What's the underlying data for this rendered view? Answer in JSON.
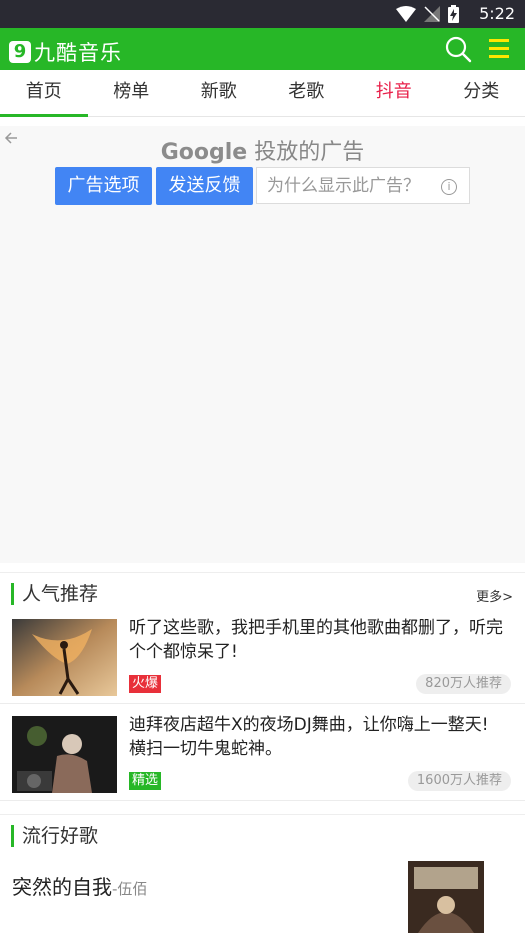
{
  "status_bar": {
    "time": "5:22",
    "icons": [
      "wifi-icon",
      "no-signal-icon",
      "battery-charging-icon"
    ]
  },
  "app_bar": {
    "logo_digit": "9",
    "logo_text": "九酷音乐",
    "icons": [
      "search-icon",
      "menu-icon"
    ],
    "accent_color": "#27b727"
  },
  "tabs": [
    {
      "label": "首页",
      "active": true
    },
    {
      "label": "榜单"
    },
    {
      "label": "新歌"
    },
    {
      "label": "老歌"
    },
    {
      "label": "抖音",
      "highlight_color": "#e8204a"
    },
    {
      "label": "分类"
    }
  ],
  "ad": {
    "brand_google": "Google",
    "brand_text": "投放的广告",
    "buttons": [
      "广告选项",
      "发送反馈"
    ],
    "why_text": "为什么显示此广告？",
    "button_color": "#4285f4"
  },
  "popular": {
    "title": "人气推荐",
    "more": "更多>",
    "items": [
      {
        "title": "听了这些歌，我把手机里的其他歌曲都删了，听完个个都惊呆了!",
        "tag": "火爆",
        "tag_color": "#e8303a",
        "count": "820万人推荐"
      },
      {
        "title": "迪拜夜店超牛X的夜场DJ舞曲，让你嗨上一整天! 横扫一切牛鬼蛇神。",
        "tag": "精选",
        "tag_color": "#27b727",
        "count": "1600万人推荐"
      }
    ]
  },
  "trending": {
    "title": "流行好歌",
    "songs": [
      {
        "name": "突然的自我",
        "artist": "-伍佰"
      }
    ]
  }
}
